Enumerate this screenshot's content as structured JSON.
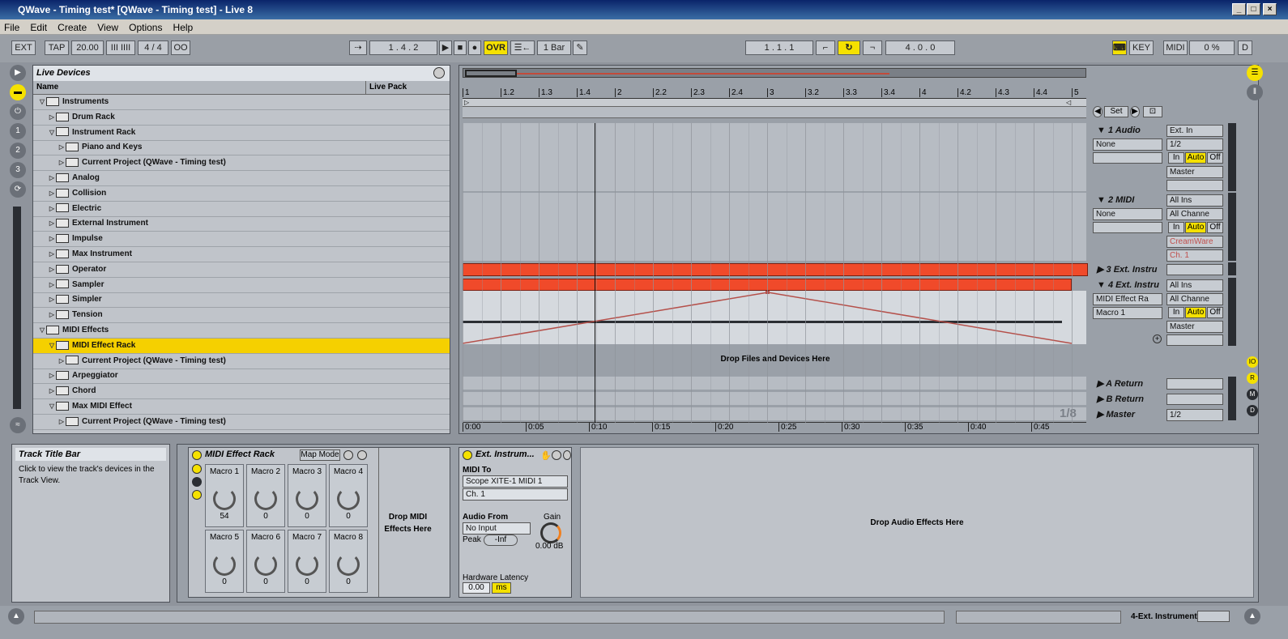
{
  "window": {
    "title": "QWave - Timing test*  [QWave - Timing test] - Live 8"
  },
  "menu": [
    "File",
    "Edit",
    "Create",
    "View",
    "Options",
    "Help"
  ],
  "transport": {
    "ext": "EXT",
    "tap": "TAP",
    "tempo": "20.00",
    "metro_icon": "III IIII",
    "signature": "4 / 4",
    "rec_circles": "OO",
    "position": "1 .  4 .  2",
    "ovr": "OVR",
    "quant": "1 Bar",
    "loop_start": "1 .  1 .  1",
    "loop_length": "4 .  0 .  0",
    "key": "KEY",
    "midi": "MIDI",
    "cpu": "0 %",
    "d": "D"
  },
  "browser": {
    "title": "Live Devices",
    "col_name": "Name",
    "col_pack": "Live Pack",
    "rows": [
      {
        "label": "Instruments",
        "indent": 0,
        "open": true
      },
      {
        "label": "Drum Rack",
        "indent": 1,
        "open": false
      },
      {
        "label": "Instrument Rack",
        "indent": 1,
        "open": true
      },
      {
        "label": "Piano and Keys",
        "indent": 2,
        "open": false
      },
      {
        "label": "Current Project (QWave - Timing test)",
        "indent": 2,
        "open": false
      },
      {
        "label": "Analog",
        "indent": 1,
        "open": false
      },
      {
        "label": "Collision",
        "indent": 1,
        "open": false
      },
      {
        "label": "Electric",
        "indent": 1,
        "open": false
      },
      {
        "label": "External Instrument",
        "indent": 1,
        "open": false
      },
      {
        "label": "Impulse",
        "indent": 1,
        "open": false
      },
      {
        "label": "Max Instrument",
        "indent": 1,
        "open": false
      },
      {
        "label": "Operator",
        "indent": 1,
        "open": false
      },
      {
        "label": "Sampler",
        "indent": 1,
        "open": false
      },
      {
        "label": "Simpler",
        "indent": 1,
        "open": false
      },
      {
        "label": "Tension",
        "indent": 1,
        "open": false
      },
      {
        "label": "MIDI Effects",
        "indent": 0,
        "open": true
      },
      {
        "label": "MIDI Effect Rack",
        "indent": 1,
        "open": true,
        "selected": true
      },
      {
        "label": "Current Project (QWave - Timing test)",
        "indent": 2,
        "open": false
      },
      {
        "label": "Arpeggiator",
        "indent": 1,
        "open": false
      },
      {
        "label": "Chord",
        "indent": 1,
        "open": false
      },
      {
        "label": "Max MIDI Effect",
        "indent": 1,
        "open": true
      },
      {
        "label": "Current Project (QWave - Timing test)",
        "indent": 2,
        "open": false
      }
    ]
  },
  "arrangement": {
    "ruler": [
      "1",
      "1.2",
      "1.3",
      "1.4",
      "2",
      "2.2",
      "2.3",
      "2.4",
      "3",
      "3.2",
      "3.3",
      "3.4",
      "4",
      "4.2",
      "4.3",
      "4.4",
      "5"
    ],
    "time_ruler": [
      "0:00",
      "0:05",
      "0:10",
      "0:15",
      "0:20",
      "0:25",
      "0:30",
      "0:35",
      "0:40",
      "0:45"
    ],
    "drop_text": "Drop Files and Devices Here",
    "zoom": "1/8",
    "set_label": "Set"
  },
  "tracks": [
    {
      "name": "1 Audio",
      "input": "Ext. In",
      "sub": "1/2",
      "left_sel": "None",
      "out": "Master"
    },
    {
      "name": "2 MIDI",
      "input": "All Ins",
      "sub": "All Channe",
      "left_sel": "None",
      "out": "CreamWare",
      "out2": "Ch. 1"
    },
    {
      "name": "3 Ext. Instru"
    },
    {
      "name": "4 Ext. Instru",
      "input": "All Ins",
      "sub": "All Channe",
      "left_sel": "MIDI Effect Ra",
      "left_sel2": "Macro 1",
      "out": "Master"
    },
    {
      "name": "A Return"
    },
    {
      "name": "B Return"
    },
    {
      "name": "Master",
      "sub": "1/2"
    }
  ],
  "monitor": {
    "in": "In",
    "auto": "Auto",
    "off": "Off"
  },
  "info": {
    "title": "Track Title Bar",
    "body": "Click to view the track's devices in the Track View."
  },
  "rack": {
    "title": "MIDI Effect Rack",
    "map_mode": "Map Mode",
    "macros": [
      {
        "label": "Macro 1",
        "value": "54"
      },
      {
        "label": "Macro 2",
        "value": "0"
      },
      {
        "label": "Macro 3",
        "value": "0"
      },
      {
        "label": "Macro 4",
        "value": "0"
      },
      {
        "label": "Macro 5",
        "value": "0"
      },
      {
        "label": "Macro 6",
        "value": "0"
      },
      {
        "label": "Macro 7",
        "value": "0"
      },
      {
        "label": "Macro 8",
        "value": "0"
      }
    ],
    "drop": "Drop MIDI Effects Here"
  },
  "ext_inst": {
    "title": "Ext. Instrum...",
    "midi_to": "MIDI To",
    "midi_dev": "Scope XITE-1 MIDI 1",
    "midi_ch": "Ch. 1",
    "audio_from": "Audio From",
    "gain": "Gain",
    "no_input": "No Input",
    "peak": "Peak",
    "peak_val": "-Inf",
    "gain_val": "0.00 dB",
    "latency": "Hardware Latency",
    "latency_val": "0.00",
    "ms": "ms"
  },
  "audio_drop": "Drop Audio Effects Here",
  "status": {
    "track": "4-Ext. Instrument"
  }
}
